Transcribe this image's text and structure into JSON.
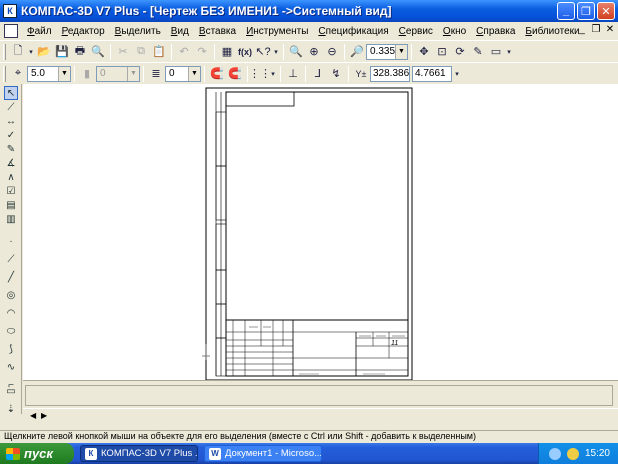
{
  "window": {
    "title": "КОМПАС-3D V7 Plus - [Чертеж БЕЗ ИМЕНИ1 ->Системный вид]"
  },
  "menu": {
    "items": [
      "Файл",
      "Редактор",
      "Выделить",
      "Вид",
      "Вставка",
      "Инструменты",
      "Спецификация",
      "Сервис",
      "Окно",
      "Справка",
      "Библиотеки"
    ]
  },
  "toolbar1": {
    "zoom_value": "0.3354"
  },
  "toolbar2": {
    "step_value": "5.0",
    "layer_value": "0",
    "view_value": "0",
    "coord_x": "328.386",
    "coord_y": "4.7661"
  },
  "drawing": {
    "sheet_number": "11"
  },
  "statusbar": {
    "text": "Щелкните левой кнопкой мыши на объекте для его выделения (вместе с Ctrl или Shift - добавить к выделенным)"
  },
  "taskbar": {
    "start_label": "пуск",
    "tasks": [
      "КОМПАС-3D V7 Plus ...",
      "Документ1 - Microso..."
    ],
    "clock": "15:20"
  }
}
